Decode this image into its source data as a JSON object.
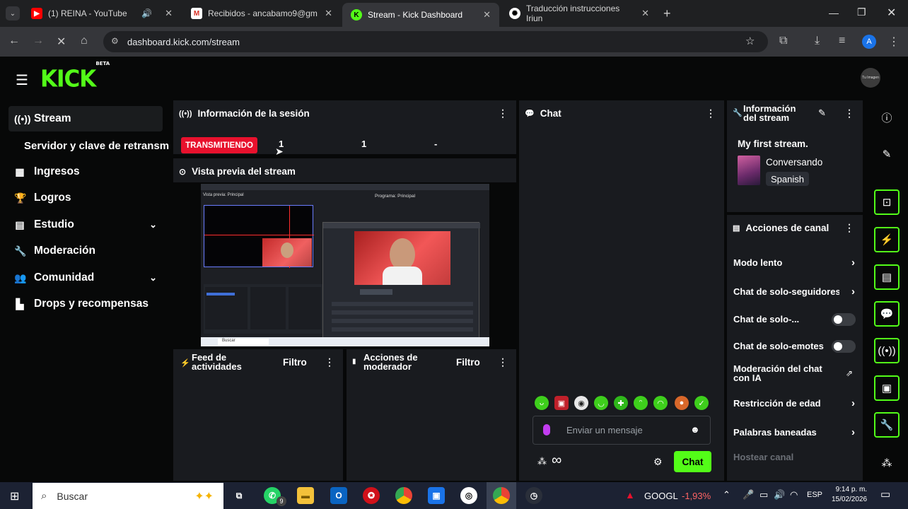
{
  "browser": {
    "tabs": [
      {
        "title": "(1) REINA - YouTube",
        "icon": "youtube-icon"
      },
      {
        "title": "Recibidos - ancabamo9@gmail",
        "icon": "gmail-icon"
      },
      {
        "title": "Stream - Kick Dashboard",
        "icon": "kick-icon"
      },
      {
        "title": "Traducción instrucciones Iriun",
        "icon": "chatgpt-icon"
      }
    ],
    "url": "dashboard.kick.com/stream",
    "profile_initial": "A"
  },
  "kick": {
    "logo": "KICK",
    "logo_badge": "BETA",
    "avatar_label": "Tu Imagen"
  },
  "sidebar": {
    "items": [
      {
        "label": "Stream",
        "icon": "broadcast-icon"
      },
      {
        "label": "Servidor y clave de retransm",
        "icon": ""
      },
      {
        "label": "Ingresos",
        "icon": "chart-icon"
      },
      {
        "label": "Logros",
        "icon": "trophy-icon"
      },
      {
        "label": "Estudio",
        "icon": "studio-icon"
      },
      {
        "label": "Moderación",
        "icon": "wrench-icon"
      },
      {
        "label": "Comunidad",
        "icon": "people-icon"
      },
      {
        "label": "Drops y recompensas",
        "icon": "drops-icon"
      }
    ]
  },
  "session": {
    "title": "Información de la sesión",
    "status": "TRANSMITIENDO",
    "stat1": "1",
    "stat2": "1",
    "stat3": "-"
  },
  "preview": {
    "title": "Vista previa del stream",
    "obs_left_label": "Vista previa: Principal",
    "obs_right_label": "Programa: Principal",
    "obs_taskbar_search": "Buscar"
  },
  "feed": {
    "title_line1": "Feed de",
    "title_line2": "actividades",
    "filter": "Filtro"
  },
  "modactions": {
    "title_line1": "Acciones de",
    "title_line2": "moderador",
    "filter": "Filtro"
  },
  "chat": {
    "title": "Chat",
    "placeholder": "Enviar un mensaje",
    "send": "Chat",
    "infinity": "∞"
  },
  "streaminfo": {
    "title_line1": "Información",
    "title_line2": "del stream",
    "stream_title": "My first stream.",
    "category": "Conversando",
    "language": "Spanish"
  },
  "channel_actions": {
    "title": "Acciones de canal",
    "items": [
      {
        "label": "Modo lento",
        "control": "arrow"
      },
      {
        "label": "Chat de solo-seguidores",
        "control": "arrow"
      },
      {
        "label": "Chat de solo-...",
        "control": "toggle"
      },
      {
        "label": "Chat de solo-emotes",
        "control": "toggle"
      },
      {
        "label": "Moderación del chat con IA",
        "control": "external"
      },
      {
        "label": "Restricción de edad",
        "control": "arrow"
      },
      {
        "label": "Palabras baneadas",
        "control": "arrow"
      },
      {
        "label": "Hostear canal",
        "control": "none"
      }
    ]
  },
  "taskbar": {
    "search_placeholder": "Buscar",
    "whatsapp_badge": "9",
    "stock_name": "GOOGL",
    "stock_change": "-1,93%",
    "language": "ESP",
    "time": "9:14 p. m.",
    "date": "15/02/2026"
  },
  "colors": {
    "accent": "#53fc18",
    "live": "#e8112d",
    "panel": "#191b1f",
    "background": "#070808"
  }
}
